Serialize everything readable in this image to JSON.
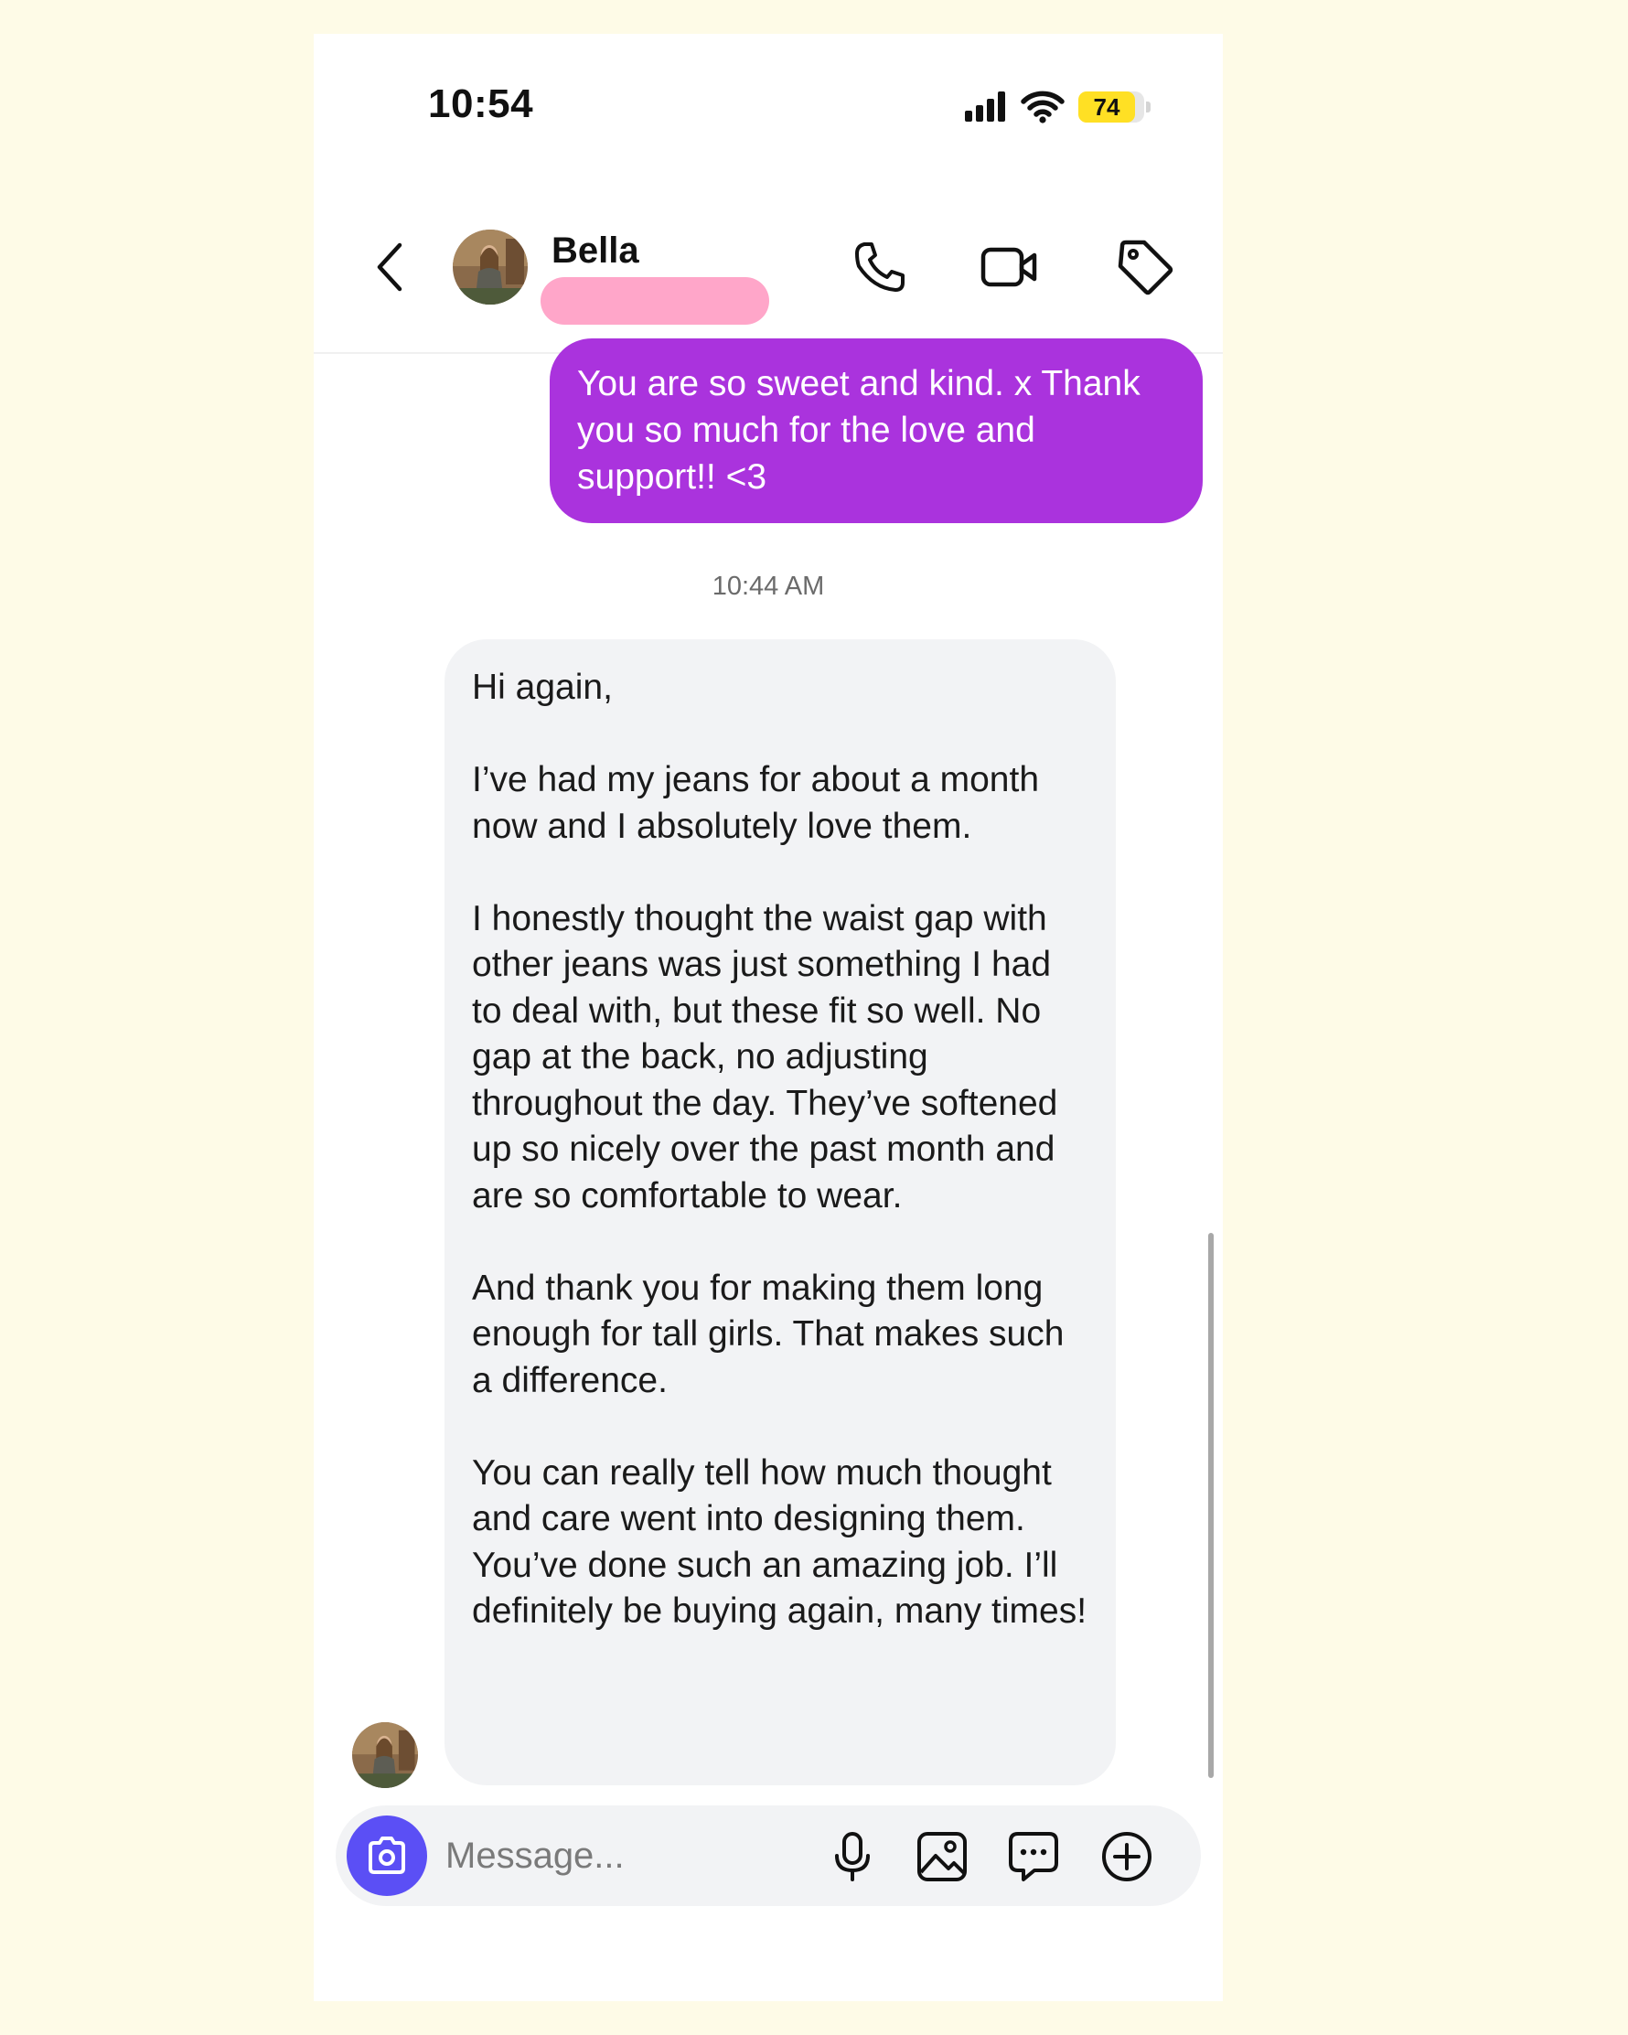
{
  "status_bar": {
    "time": "10:54",
    "battery_level": "74",
    "icons": [
      "signal-icon",
      "wifi-icon",
      "battery-icon"
    ]
  },
  "header": {
    "contact_name": "Bella",
    "icons": [
      "back-chevron-icon",
      "phone-icon",
      "video-camera-icon",
      "tag-icon"
    ]
  },
  "conversation": {
    "outgoing_message": "You are so sweet and kind. x Thank you so much for the love and support!! <3",
    "timestamp": "10:44 AM",
    "incoming_message": "Hi again,\n\nI’ve had my jeans for about a month now and I absolutely love them.\n\nI honestly thought the waist gap with other jeans was just something I had to deal with, but these fit so well. No gap at the back, no adjusting throughout the day. They’ve softened up so nicely over the past month and are so comfortable to wear.\n\nAnd thank you for making them long enough for tall girls. That makes such a difference.\n\nYou can really tell how much thought and care went into designing them. You’ve done such an amazing job. I’ll definitely be buying again, many times!"
  },
  "composer": {
    "placeholder": "Message...",
    "icons": [
      "camera-icon",
      "microphone-icon",
      "image-icon",
      "sticker-chat-icon",
      "plus-circle-icon"
    ]
  },
  "colors": {
    "page_background": "#fefbe7",
    "outgoing_bubble": "#aa33dd",
    "incoming_bubble": "#f2f3f5",
    "camera_button": "#5b4ff5",
    "redaction": "#ffa6c9",
    "battery": "#ffe024"
  }
}
